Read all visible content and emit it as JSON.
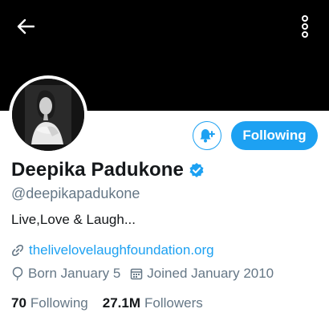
{
  "profile": {
    "name": "Deepika Padukone",
    "handle": "@deepikapadukone",
    "bio": "Live,Love & Laugh...",
    "website": "thelivelovelaughfoundation.org",
    "born": "Born January 5",
    "joined": "Joined January 2010",
    "verified": true
  },
  "actions": {
    "following_label": "Following"
  },
  "stats": {
    "following_count": "70",
    "following_label": "Following",
    "followers_count": "27.1M",
    "followers_label": "Followers"
  },
  "colors": {
    "accent": "#1da1f2",
    "banner": "#000000",
    "text_primary": "#14171a",
    "text_secondary": "#657786"
  },
  "icons": {
    "back": "arrow-left-icon",
    "more": "more-vertical-icon",
    "notify": "bell-plus-icon",
    "verified": "verified-badge-icon",
    "link": "link-icon",
    "born": "balloon-icon",
    "joined": "calendar-icon"
  }
}
